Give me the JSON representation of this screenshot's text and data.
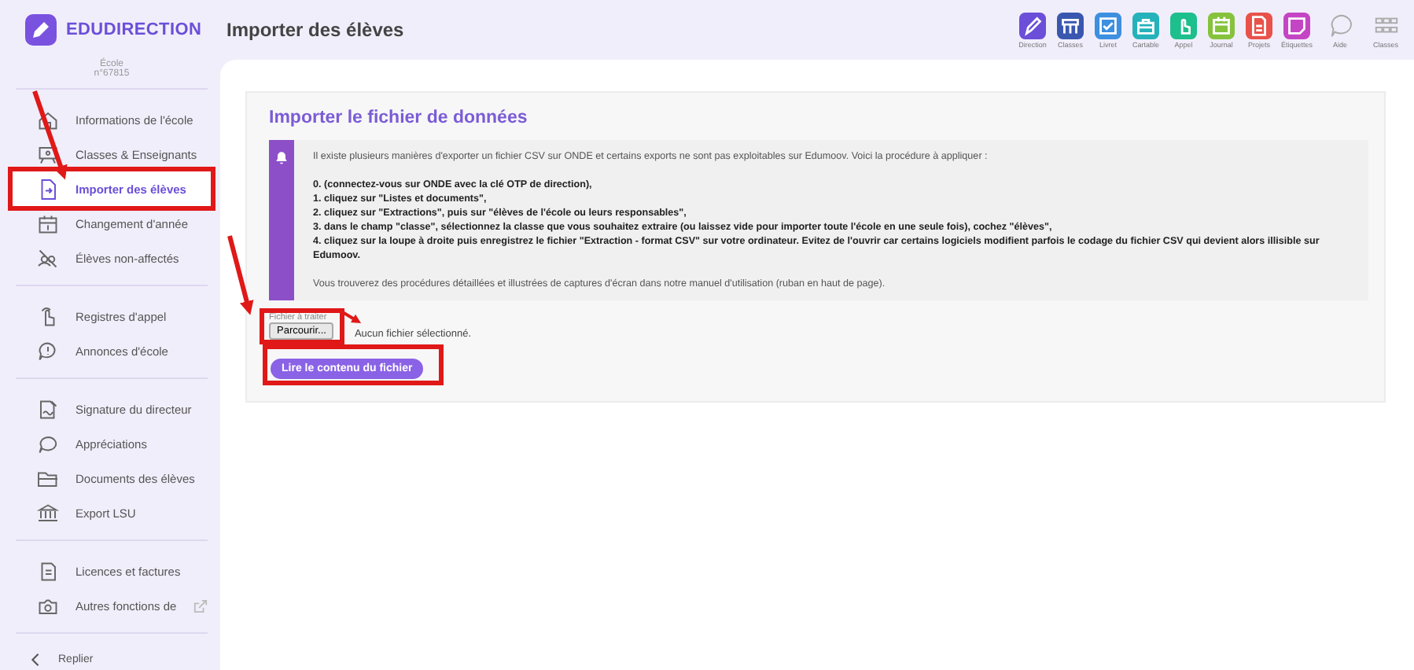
{
  "app": {
    "logo": "EDUDIRECTION",
    "school": [
      "École",
      "n°67815"
    ]
  },
  "header": {
    "title": "Importer des élèves"
  },
  "toolbar": [
    {
      "label": "Direction",
      "color": "#6b4fd8"
    },
    {
      "label": "Classes",
      "color": "#3a57b0"
    },
    {
      "label": "Livret",
      "color": "#3d8fe0"
    },
    {
      "label": "Cartable",
      "color": "#25b2ba"
    },
    {
      "label": "Appel",
      "color": "#1dbf8c"
    },
    {
      "label": "Journal",
      "color": "#86c23c"
    },
    {
      "label": "Projets",
      "color": "#e8524a"
    },
    {
      "label": "Étiquettes",
      "color": "#c445c4"
    }
  ],
  "toolbar_extra": [
    {
      "label": "Aide"
    },
    {
      "label": "Classes"
    }
  ],
  "sidebar": {
    "groups": [
      {
        "items": [
          {
            "label": "Informations de l'école",
            "selected": false
          },
          {
            "label": "Classes & Enseignants",
            "selected": false
          },
          {
            "label": "Importer des élèves",
            "selected": true,
            "highlighted": true
          },
          {
            "label": "Changement d'année",
            "selected": false
          },
          {
            "label": "Élèves non-affectés",
            "selected": false
          }
        ]
      },
      {
        "items": [
          {
            "label": "Registres d'appel",
            "selected": false
          },
          {
            "label": "Annonces d'école",
            "selected": false
          }
        ]
      },
      {
        "items": [
          {
            "label": "Signature du directeur",
            "selected": false
          },
          {
            "label": "Appréciations",
            "selected": false
          },
          {
            "label": "Documents des élèves",
            "selected": false
          },
          {
            "label": "Export LSU",
            "selected": false
          }
        ]
      },
      {
        "items": [
          {
            "label": "Licences et factures",
            "selected": false
          },
          {
            "label": "Autres fonctions de",
            "selected": false,
            "external": true
          }
        ]
      }
    ],
    "collapse": "Replier"
  },
  "panel": {
    "title": "Importer le fichier de données",
    "info": {
      "intro": "Il existe plusieurs manières d'exporter un fichier CSV sur ONDE et certains exports ne sont pas exploitables sur Edumoov. Voici la procédure à appliquer :",
      "steps": [
        "0. (connectez-vous sur ONDE avec la clé OTP de direction),",
        "1. cliquez sur \"Listes et documents\",",
        "2. cliquez sur \"Extractions\", puis sur \"élèves de l'école ou leurs responsables\",",
        "3. dans le champ \"classe\", sélectionnez la classe que vous souhaitez extraire (ou laissez vide pour importer toute l'école en une seule fois), cochez \"élèves\",",
        "4. cliquez sur la loupe à droite puis enregistrez le fichier \"Extraction - format CSV\" sur votre ordinateur. Evitez de l'ouvrir car certains logiciels modifient parfois le codage du fichier CSV qui devient alors illisible sur Edumoov."
      ],
      "outro": "Vous trouverez des procédures détaillées et illustrées de captures d'écran dans notre manuel d'utilisation (ruban en haut de page)."
    },
    "file": {
      "label": "Fichier à traiter",
      "browse": "Parcourir...",
      "status": "Aucun fichier sélectionné.",
      "highlighted": true
    },
    "submit": {
      "label": "Lire le contenu du fichier",
      "highlighted": true
    }
  }
}
